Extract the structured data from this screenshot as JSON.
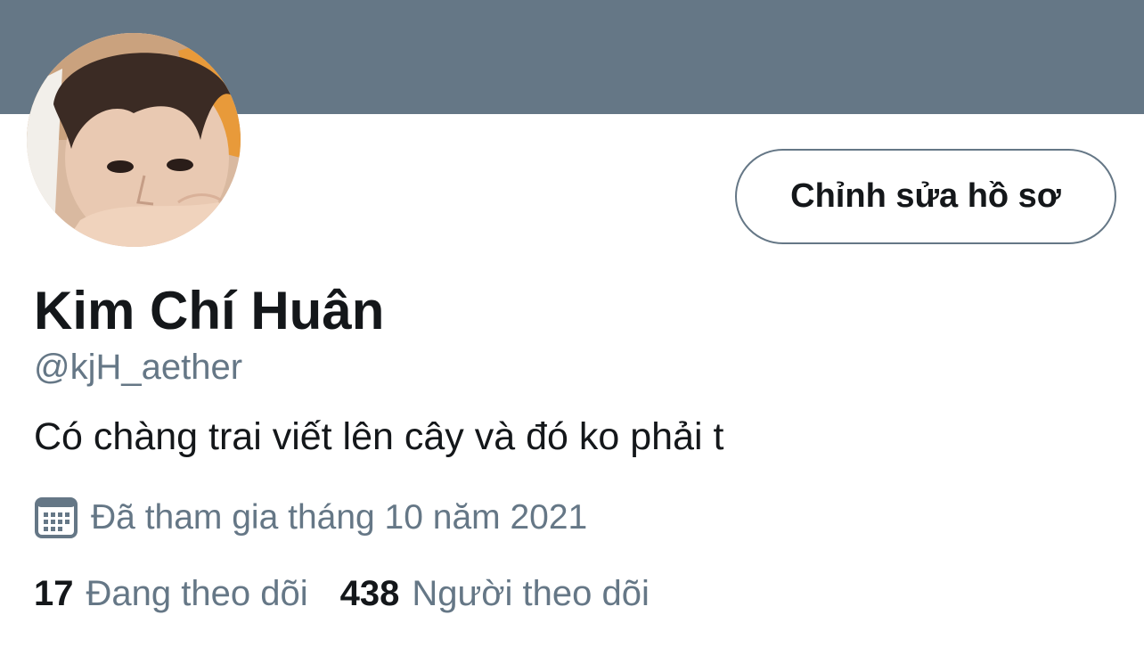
{
  "profile": {
    "display_name": "Kim Chí Huân",
    "handle": "@kjH_aether",
    "bio": "Có chàng trai viết lên cây và đó ko phải t",
    "joined": "Đã tham gia tháng 10 năm 2021",
    "edit_button_label": "Chỉnh sửa hồ sơ",
    "stats": {
      "following_count": "17",
      "following_label": "Đang theo dõi",
      "followers_count": "438",
      "followers_label": "Người theo dõi"
    }
  },
  "icons": {
    "joined_icon": "calendar-icon"
  },
  "colors": {
    "banner": "#657786",
    "primary_text": "#14171a",
    "secondary_text": "#657786",
    "background": "#ffffff"
  }
}
